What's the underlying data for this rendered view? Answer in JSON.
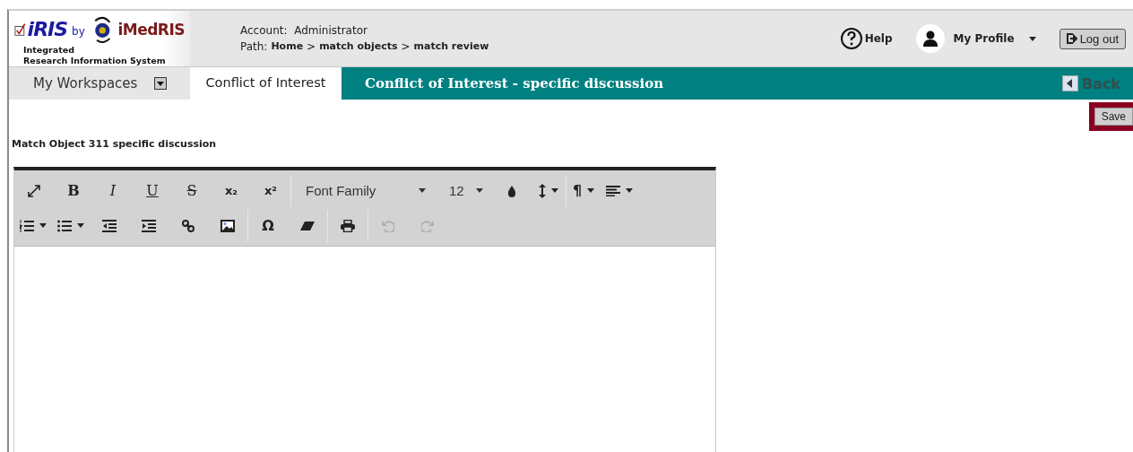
{
  "logo": {
    "product": "iRIS",
    "by": "by",
    "company": "iMedRIS",
    "tagline_1": "Integrated",
    "tagline_2": "Research Information System"
  },
  "account": {
    "label": "Account:",
    "value": "Administrator"
  },
  "path": {
    "label": "Path:",
    "separator": ">",
    "crumbs": [
      "Home",
      "match objects",
      "match review"
    ]
  },
  "help": "Help",
  "profile": "My Profile",
  "logout": "Log out",
  "workspaces": "My Workspaces",
  "tabs": [
    {
      "label": "Conflict of Interest",
      "selected": true
    }
  ],
  "page_title": "Conflict of Interest - specific discussion",
  "back": "Back",
  "save": "Save",
  "field_label": "Match Object 311 specific discussion",
  "toolbar_rows": [
    [
      {
        "kind": "expand",
        "disabled": false,
        "dropdown": false
      },
      {
        "kind": "bold",
        "label": "B",
        "disabled": false,
        "dropdown": false
      },
      {
        "kind": "italic",
        "label": "I",
        "disabled": false,
        "dropdown": false
      },
      {
        "kind": "underline",
        "label": "U",
        "disabled": false,
        "dropdown": false
      },
      {
        "kind": "strike",
        "label": "S",
        "disabled": false,
        "dropdown": false
      },
      {
        "kind": "script",
        "label": "x₂",
        "disabled": false,
        "dropdown": false
      },
      {
        "kind": "script",
        "label": "x²",
        "disabled": false,
        "dropdown": false
      },
      {
        "kind": "separator"
      },
      {
        "kind": "select",
        "label": "Font Family",
        "disabled": false,
        "dropdown": true
      },
      {
        "kind": "select",
        "label": "12",
        "disabled": false,
        "dropdown": true
      },
      {
        "kind": "drop",
        "disabled": false,
        "dropdown": false
      },
      {
        "kind": "lineheight",
        "disabled": false,
        "dropdown": true
      },
      {
        "kind": "separator"
      },
      {
        "kind": "symbol",
        "label": "¶",
        "disabled": false,
        "dropdown": true
      },
      {
        "kind": "align",
        "disabled": false,
        "dropdown": true
      }
    ],
    [
      {
        "kind": "olist",
        "disabled": false,
        "dropdown": true
      },
      {
        "kind": "ulist",
        "disabled": false,
        "dropdown": true
      },
      {
        "kind": "outdent",
        "disabled": false,
        "dropdown": false
      },
      {
        "kind": "indent",
        "disabled": false,
        "dropdown": false
      },
      {
        "kind": "link",
        "disabled": false,
        "dropdown": false
      },
      {
        "kind": "image",
        "disabled": false,
        "dropdown": false
      },
      {
        "kind": "separator"
      },
      {
        "kind": "symbol",
        "label": "Ω",
        "disabled": false,
        "dropdown": false
      },
      {
        "kind": "eraser",
        "disabled": false,
        "dropdown": false
      },
      {
        "kind": "separator"
      },
      {
        "kind": "print",
        "disabled": false,
        "dropdown": false
      },
      {
        "kind": "separator"
      },
      {
        "kind": "undo",
        "disabled": true,
        "dropdown": false
      },
      {
        "kind": "redo",
        "disabled": true,
        "dropdown": false
      }
    ]
  ]
}
